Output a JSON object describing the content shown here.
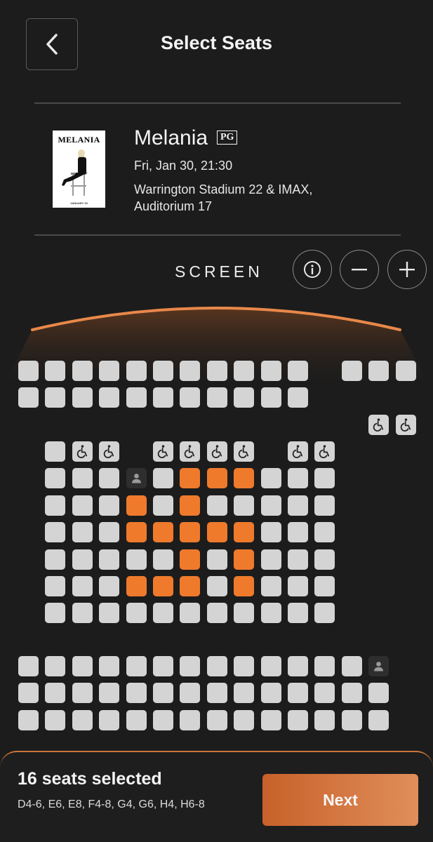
{
  "header": {
    "title": "Select Seats"
  },
  "movie": {
    "poster_title": "MELANIA",
    "poster_date": "JANUARY 30",
    "title": "Melania",
    "rating": "PG",
    "showtime": "Fri, Jan 30, 21:30",
    "venue_line1": "Warrington Stadium 22 & IMAX,",
    "venue_line2": "Auditorium 17"
  },
  "screen": {
    "label": "SCREEN"
  },
  "controls": {
    "info_icon": "info-icon",
    "zoom_out_icon": "minus-icon",
    "zoom_in_icon": "plus-icon"
  },
  "colors": {
    "accent": "#ef7a2c",
    "available": "#d4d4d4",
    "occupied": "#2e2e2e",
    "background": "#1c1c1c"
  },
  "seat_rows": [
    {
      "cols": [
        {
          "from": 0,
          "to": 10,
          "t": "a"
        },
        {
          "from": 12,
          "to": 14,
          "t": "a"
        }
      ]
    },
    {
      "cols": [
        {
          "from": 0,
          "to": 10,
          "t": "a"
        }
      ]
    },
    {
      "cols": [
        {
          "from": 13,
          "to": 14,
          "t": "w"
        }
      ]
    },
    {
      "cols": [
        {
          "from": 1,
          "to": 1,
          "t": "a"
        },
        {
          "from": 2,
          "to": 3,
          "t": "w"
        },
        {
          "from": 5,
          "to": 8,
          "t": "w"
        },
        {
          "from": 10,
          "to": 11,
          "t": "w"
        }
      ]
    },
    {
      "cols": [
        {
          "from": 1,
          "to": 3,
          "t": "a"
        },
        {
          "from": 4,
          "to": 4,
          "t": "o"
        },
        {
          "from": 5,
          "to": 5,
          "t": "a"
        },
        {
          "from": 6,
          "to": 8,
          "t": "s"
        },
        {
          "from": 9,
          "to": 11,
          "t": "a"
        }
      ]
    },
    {
      "cols": [
        {
          "from": 1,
          "to": 3,
          "t": "a"
        },
        {
          "from": 4,
          "to": 4,
          "t": "s"
        },
        {
          "from": 5,
          "to": 5,
          "t": "a"
        },
        {
          "from": 6,
          "to": 6,
          "t": "s"
        },
        {
          "from": 7,
          "to": 11,
          "t": "a"
        }
      ]
    },
    {
      "cols": [
        {
          "from": 1,
          "to": 3,
          "t": "a"
        },
        {
          "from": 4,
          "to": 8,
          "t": "s"
        },
        {
          "from": 9,
          "to": 11,
          "t": "a"
        }
      ]
    },
    {
      "cols": [
        {
          "from": 1,
          "to": 5,
          "t": "a"
        },
        {
          "from": 6,
          "to": 6,
          "t": "s"
        },
        {
          "from": 7,
          "to": 7,
          "t": "a"
        },
        {
          "from": 8,
          "to": 8,
          "t": "s"
        },
        {
          "from": 9,
          "to": 11,
          "t": "a"
        }
      ]
    },
    {
      "cols": [
        {
          "from": 1,
          "to": 3,
          "t": "a"
        },
        {
          "from": 4,
          "to": 6,
          "t": "s"
        },
        {
          "from": 7,
          "to": 7,
          "t": "a"
        },
        {
          "from": 8,
          "to": 8,
          "t": "s"
        },
        {
          "from": 9,
          "to": 11,
          "t": "a"
        }
      ]
    },
    {
      "cols": [
        {
          "from": 1,
          "to": 11,
          "t": "a"
        }
      ]
    },
    {
      "cols": [
        {
          "from": 0,
          "to": 12,
          "t": "a"
        },
        {
          "from": 13,
          "to": 13,
          "t": "o"
        }
      ]
    },
    {
      "cols": [
        {
          "from": 0,
          "to": 13,
          "t": "a"
        }
      ]
    },
    {
      "cols": [
        {
          "from": 0,
          "to": 13,
          "t": "a"
        }
      ]
    }
  ],
  "footer": {
    "selected_count": "16 seats selected",
    "selected_list": "D4-6, E6, E8, F4-8, G4, G6, H4, H6-8",
    "next_label": "Next"
  }
}
